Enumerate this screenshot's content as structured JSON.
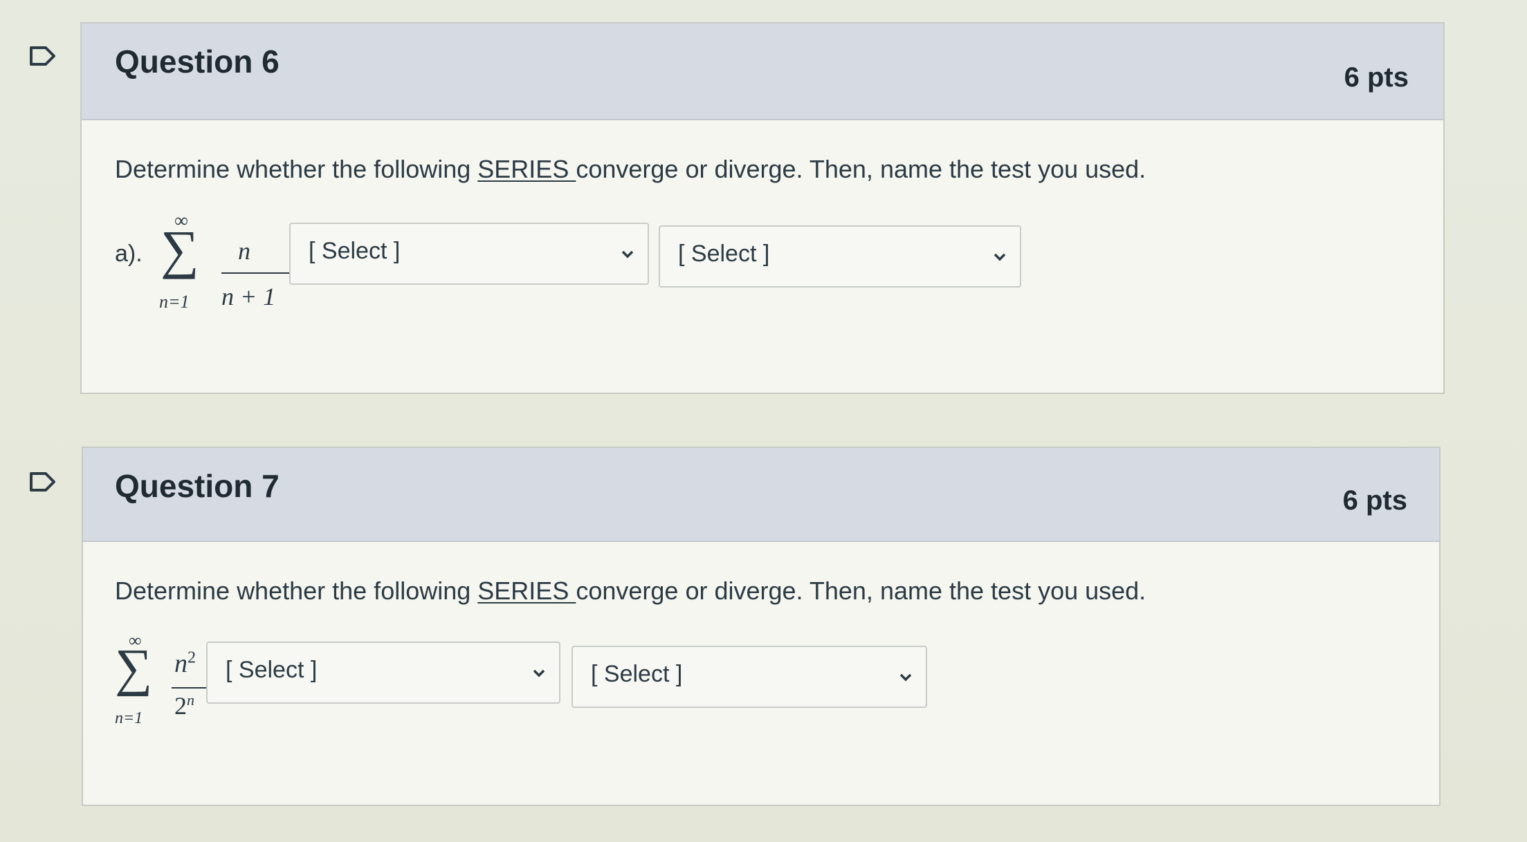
{
  "questions": [
    {
      "title": "Question 6",
      "points": "6 pts",
      "prompt_before": "Determine whether the following ",
      "prompt_emphasis": "SERIES ",
      "prompt_after": "converge or diverge. Then, name the test you used.",
      "part_label": "a).",
      "formula": {
        "upper_limit": "∞",
        "sum_symbol": "∑",
        "lower_limit": "n=1",
        "numerator": "n",
        "denominator": "n + 1"
      },
      "dropdowns": [
        {
          "selected": "[ Select ]"
        },
        {
          "selected": "[ Select ]"
        }
      ]
    },
    {
      "title": "Question 7",
      "points": "6 pts",
      "prompt_before": "Determine whether the following ",
      "prompt_emphasis": "SERIES ",
      "prompt_after": "converge or diverge. Then, name the test you used.",
      "formula": {
        "upper_limit": "∞",
        "sum_symbol": "∑",
        "lower_limit": "n=1",
        "numerator_base": "n",
        "numerator_exp": "2",
        "denominator_base": "2",
        "denominator_exp": "n"
      },
      "dropdowns": [
        {
          "selected": "[ Select ]"
        },
        {
          "selected": "[ Select ]"
        }
      ]
    }
  ],
  "icons": {
    "flag": "bookmark-flag-icon",
    "chevron": "chevron-down-icon"
  },
  "colors": {
    "header_bg": "#d6dae3",
    "panel_bg": "#f5f6ef",
    "border": "#c7cbc5",
    "text": "#2d3b45"
  }
}
